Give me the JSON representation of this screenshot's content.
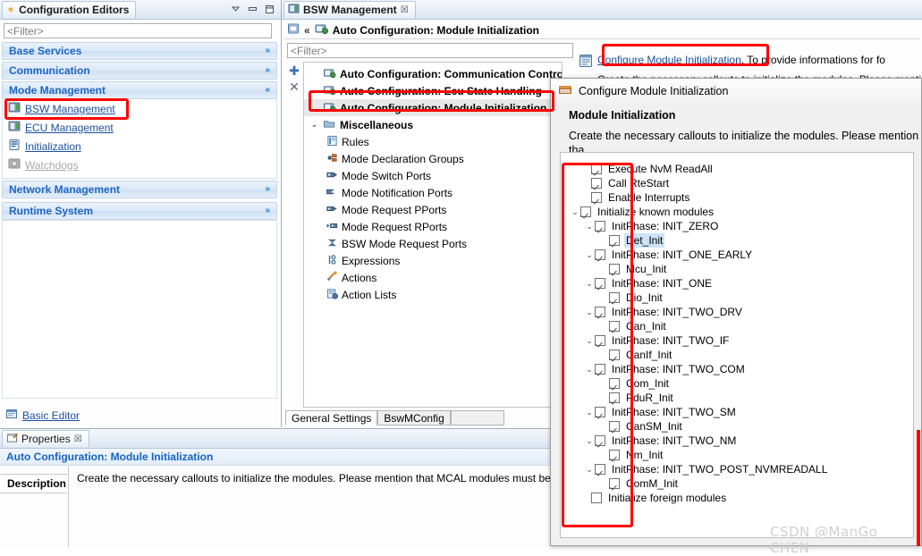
{
  "left_panel": {
    "tab_label": "Configuration Editors",
    "tab_icon": "asterisk-icon",
    "filter_placeholder": "<Filter>",
    "chrome": [
      "view-menu-icon",
      "minimize-icon",
      "maximize-icon"
    ],
    "sections": [
      {
        "label": "Base Services",
        "expanded": false,
        "chevron": "»"
      },
      {
        "label": "Communication",
        "expanded": false,
        "chevron": "»"
      },
      {
        "label": "Mode Management",
        "expanded": true,
        "chevron": "«",
        "items": [
          {
            "label": "BSW Management",
            "icon": "bsw-management-icon",
            "enabled": true,
            "highlighted": true
          },
          {
            "label": "ECU Management",
            "icon": "ecu-management-icon",
            "enabled": true,
            "highlighted": false
          },
          {
            "label": "Initialization",
            "icon": "initialization-icon",
            "enabled": true,
            "highlighted": false
          },
          {
            "label": "Watchdogs",
            "icon": "watchdogs-icon",
            "enabled": false,
            "highlighted": false
          }
        ]
      },
      {
        "label": "Network Management",
        "expanded": false,
        "chevron": "»"
      },
      {
        "label": "Runtime System",
        "expanded": false,
        "chevron": "»"
      }
    ],
    "basic_editor": {
      "label": "Basic Editor",
      "icon": "basic-editor-icon"
    }
  },
  "editor": {
    "tab_label": "BSW Management",
    "tab_icon": "bsw-management-icon",
    "tab_close": "☒",
    "breadcrumb": {
      "home_icon": "home-icon",
      "separator": "«",
      "node_icon": "auto-config-icon",
      "label": "Auto Configuration: Module Initialization"
    },
    "filter_placeholder": "<Filter>",
    "tools": [
      {
        "name": "add-button",
        "glyph": "✚"
      },
      {
        "name": "delete-button",
        "glyph": "✕"
      }
    ],
    "tree": [
      {
        "label": "Auto Configuration: Communication Control",
        "icon": "auto-config-icon",
        "indent": 0,
        "bold": true,
        "twisty": "",
        "selected": false
      },
      {
        "label": "Auto Configuration: Ecu State Handling",
        "icon": "auto-config-icon",
        "indent": 0,
        "bold": true,
        "twisty": "›",
        "selected": false
      },
      {
        "label": "Auto Configuration: Module Initialization",
        "icon": "auto-config-icon",
        "indent": 0,
        "bold": true,
        "twisty": "",
        "selected": true
      },
      {
        "label": "Miscellaneous",
        "icon": "folder-icon",
        "indent": 0,
        "bold": true,
        "twisty": "⌄",
        "selected": false
      },
      {
        "label": "Rules",
        "icon": "rules-icon",
        "indent": 1,
        "bold": false,
        "twisty": "",
        "selected": false
      },
      {
        "label": "Mode Declaration Groups",
        "icon": "mode-declaration-groups-icon",
        "indent": 1,
        "bold": false,
        "twisty": "",
        "selected": false
      },
      {
        "label": "Mode Switch Ports",
        "icon": "mode-switch-ports-icon",
        "indent": 1,
        "bold": false,
        "twisty": "",
        "selected": false
      },
      {
        "label": "Mode Notification Ports",
        "icon": "mode-notification-ports-icon",
        "indent": 1,
        "bold": false,
        "twisty": "",
        "selected": false
      },
      {
        "label": "Mode Request PPorts",
        "icon": "mode-request-pports-icon",
        "indent": 1,
        "bold": false,
        "twisty": "",
        "selected": false
      },
      {
        "label": "Mode Request RPorts",
        "icon": "mode-request-rports-icon",
        "indent": 1,
        "bold": false,
        "twisty": "",
        "selected": false
      },
      {
        "label": "BSW Mode Request Ports",
        "icon": "bsw-mode-request-ports-icon",
        "indent": 1,
        "bold": false,
        "twisty": "",
        "selected": false
      },
      {
        "label": "Expressions",
        "icon": "expressions-icon",
        "indent": 1,
        "bold": false,
        "twisty": "",
        "selected": false
      },
      {
        "label": "Actions",
        "icon": "actions-icon",
        "indent": 1,
        "bold": false,
        "twisty": "",
        "selected": false
      },
      {
        "label": "Action Lists",
        "icon": "action-lists-icon",
        "indent": 1,
        "bold": false,
        "twisty": "",
        "selected": false
      }
    ],
    "bottom_tabs": [
      {
        "label": "General Settings",
        "active": true
      },
      {
        "label": "BswMConfig",
        "active": false
      }
    ],
    "form": {
      "link_icon": "configure-icon",
      "link_text": "Configure Module Initialization",
      "link_suffix": ". To provide informations for fo",
      "description": "Create the necessary callouts to initialize the modules. Please menti"
    }
  },
  "properties": {
    "tab_label": "Properties",
    "tab_icon": "properties-icon",
    "tab_close": "☒",
    "chrome": [
      "view-menu-icon",
      "minimize-icon"
    ],
    "title": "Auto Configuration: Module Initialization",
    "side_tab": "Description",
    "description": "Create the necessary callouts to initialize the modules. Please mention that MCAL modules must be initialized by EcuM!"
  },
  "dialog": {
    "title": "Configure Module Initialization",
    "title_icon": "autosar-dialog-icon",
    "heading": "Module Initialization",
    "subtitle": "Create the necessary callouts to initialize the modules. Please mention tha",
    "tree": [
      {
        "label": "Execute NvM ReadAll",
        "level": 0,
        "checked": true,
        "twisty": "",
        "selected": false
      },
      {
        "label": "Call RteStart",
        "level": 0,
        "checked": true,
        "twisty": "",
        "selected": false
      },
      {
        "label": "Enable Interrupts",
        "level": 0,
        "checked": true,
        "twisty": "",
        "selected": false
      },
      {
        "label": "Initialize known modules",
        "level": 0,
        "checked": true,
        "twisty": "⌄",
        "selected": false
      },
      {
        "label": "InitPhase: INIT_ZERO",
        "level": 1,
        "checked": true,
        "twisty": "⌄",
        "selected": false
      },
      {
        "label": "Det_Init",
        "level": 2,
        "checked": true,
        "twisty": "",
        "selected": true
      },
      {
        "label": "InitPhase: INIT_ONE_EARLY",
        "level": 1,
        "checked": true,
        "twisty": "⌄",
        "selected": false
      },
      {
        "label": "Mcu_Init",
        "level": 2,
        "checked": true,
        "twisty": "",
        "selected": false
      },
      {
        "label": "InitPhase: INIT_ONE",
        "level": 1,
        "checked": true,
        "twisty": "⌄",
        "selected": false
      },
      {
        "label": "Dio_Init",
        "level": 2,
        "checked": true,
        "twisty": "",
        "selected": false
      },
      {
        "label": "InitPhase: INIT_TWO_DRV",
        "level": 1,
        "checked": true,
        "twisty": "⌄",
        "selected": false
      },
      {
        "label": "Can_Init",
        "level": 2,
        "checked": true,
        "twisty": "",
        "selected": false
      },
      {
        "label": "InitPhase: INIT_TWO_IF",
        "level": 1,
        "checked": true,
        "twisty": "⌄",
        "selected": false
      },
      {
        "label": "CanIf_Init",
        "level": 2,
        "checked": true,
        "twisty": "",
        "selected": false
      },
      {
        "label": "InitPhase: INIT_TWO_COM",
        "level": 1,
        "checked": true,
        "twisty": "⌄",
        "selected": false
      },
      {
        "label": "Com_Init",
        "level": 2,
        "checked": true,
        "twisty": "",
        "selected": false
      },
      {
        "label": "PduR_Init",
        "level": 2,
        "checked": true,
        "twisty": "",
        "selected": false
      },
      {
        "label": "InitPhase: INIT_TWO_SM",
        "level": 1,
        "checked": true,
        "twisty": "⌄",
        "selected": false
      },
      {
        "label": "CanSM_Init",
        "level": 2,
        "checked": true,
        "twisty": "",
        "selected": false
      },
      {
        "label": "InitPhase: INIT_TWO_NM",
        "level": 1,
        "checked": true,
        "twisty": "⌄",
        "selected": false
      },
      {
        "label": "Nm_Init",
        "level": 2,
        "checked": true,
        "twisty": "",
        "selected": false
      },
      {
        "label": "InitPhase: INIT_TWO_POST_NVMREADALL",
        "level": 1,
        "checked": true,
        "twisty": "⌄",
        "selected": false
      },
      {
        "label": "ComM_Init",
        "level": 2,
        "checked": true,
        "twisty": "",
        "selected": false
      },
      {
        "label": "Initialize foreign modules",
        "level": 0,
        "checked": false,
        "twisty": "",
        "selected": false
      }
    ]
  },
  "annotations": {
    "color": "#fe0000",
    "boxes": [
      "bsw-management-editor-item",
      "module-initialization-tree-node",
      "configure-module-initialization-link",
      "module-initialization-checkbox-column"
    ]
  },
  "watermark": "CSDN @ManGo CHEN"
}
